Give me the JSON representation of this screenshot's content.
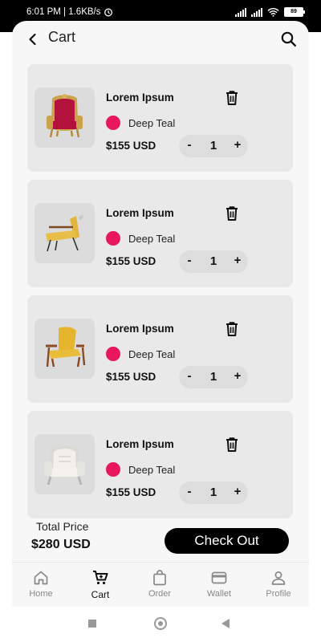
{
  "status_bar": {
    "time_speed": "6:01 PM | 1.6KB/s",
    "battery": "89"
  },
  "header": {
    "title": "Cart"
  },
  "cart_items": [
    {
      "name": "Lorem Ipsum",
      "color_name": "Deep Teal",
      "color_hex": "#e8175d",
      "price": "$155 USD",
      "quantity": "1",
      "image": "red-throne-chair"
    },
    {
      "name": "Lorem Ipsum",
      "color_name": "Deep Teal",
      "color_hex": "#e8175d",
      "price": "$155 USD",
      "quantity": "1",
      "image": "yellow-lounge-chair"
    },
    {
      "name": "Lorem Ipsum",
      "color_name": "Deep Teal",
      "color_hex": "#e8175d",
      "price": "$155 USD",
      "quantity": "1",
      "image": "yellow-armchair"
    },
    {
      "name": "Lorem Ipsum",
      "color_name": "Deep Teal",
      "color_hex": "#e8175d",
      "price": "$155 USD",
      "quantity": "1",
      "image": "white-baroque-chair"
    }
  ],
  "stepper": {
    "minus": "-",
    "plus": "+"
  },
  "summary": {
    "total_label": "Total Price",
    "total_value": "$280 USD",
    "checkout_label": "Check Out"
  },
  "bottom_nav": [
    {
      "label": "Home",
      "icon": "home-icon",
      "active": false
    },
    {
      "label": "Cart",
      "icon": "cart-icon",
      "active": true
    },
    {
      "label": "Order",
      "icon": "bag-icon",
      "active": false
    },
    {
      "label": "Wallet",
      "icon": "wallet-icon",
      "active": false
    },
    {
      "label": "Profile",
      "icon": "profile-icon",
      "active": false
    }
  ],
  "colors": {
    "accent": "#000000",
    "dot": "#e8175d",
    "card_bg": "#e9e9e9"
  }
}
